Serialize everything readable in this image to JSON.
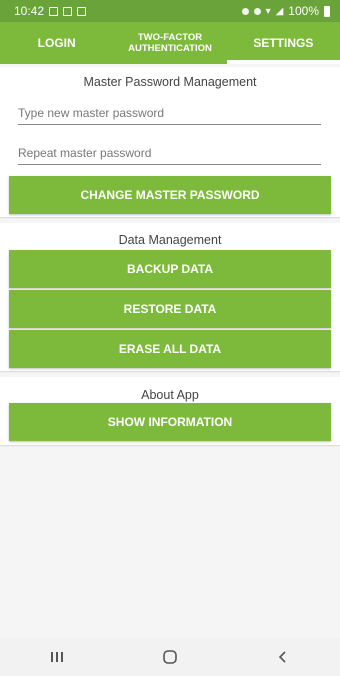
{
  "status_bar": {
    "time": "10:42",
    "battery": "100%"
  },
  "tabs": [
    {
      "label": "LOGIN"
    },
    {
      "label": "TWO-FACTOR AUTHENTICATION"
    },
    {
      "label": "SETTINGS"
    }
  ],
  "master_password": {
    "title": "Master Password Management",
    "new_placeholder": "Type new master password",
    "repeat_placeholder": "Repeat master password",
    "change_label": "CHANGE MASTER PASSWORD"
  },
  "data_management": {
    "title": "Data Management",
    "backup_label": "BACKUP DATA",
    "restore_label": "RESTORE DATA",
    "erase_label": "ERASE ALL DATA"
  },
  "about": {
    "title": "About App",
    "show_label": "SHOW INFORMATION"
  },
  "colors": {
    "accent": "#7dba3b",
    "status_bar": "#6aa33a"
  }
}
